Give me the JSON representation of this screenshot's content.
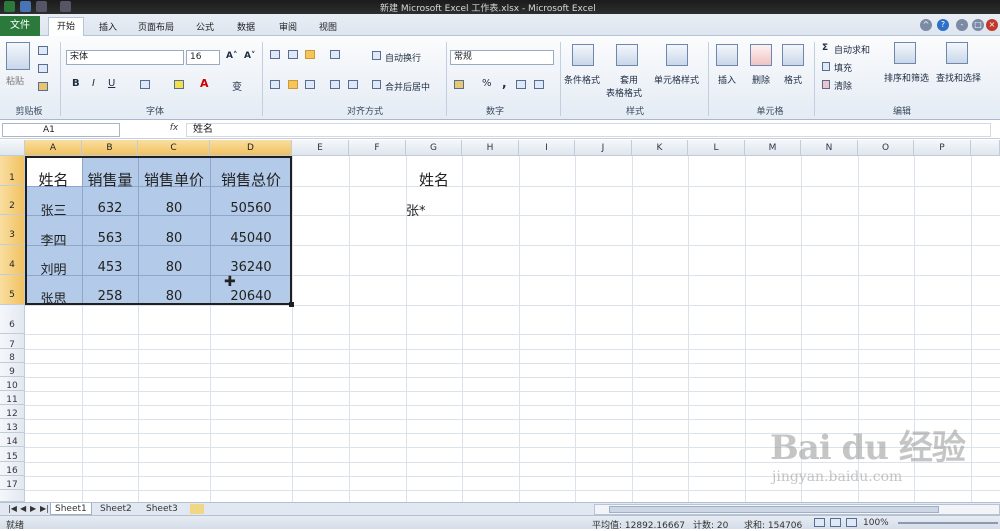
{
  "window": {
    "title": "新建 Microsoft Excel 工作表.xlsx - Microsoft Excel"
  },
  "ribbon_tabs": [
    "文件",
    "开始",
    "插入",
    "页面布局",
    "公式",
    "数据",
    "审阅",
    "视图"
  ],
  "ribbon": {
    "clipboard": {
      "paste": "粘贴",
      "group": "剪贴板"
    },
    "font": {
      "name": "宋体",
      "size": "16",
      "bold": "B",
      "italic": "I",
      "underline": "U",
      "group": "字体"
    },
    "alignment": {
      "wrap": "自动换行",
      "merge": "合并后居中",
      "group": "对齐方式"
    },
    "number": {
      "format": "常规",
      "percent": "%",
      "comma": ",",
      "group": "数字"
    },
    "styles": {
      "conditional": "条件格式",
      "table1": "套用",
      "table2": "表格格式",
      "cell_styles": "单元格样式",
      "group": "样式"
    },
    "cells": {
      "insert": "插入",
      "delete": "删除",
      "format": "格式",
      "group": "单元格"
    },
    "editing": {
      "autosum": "自动求和",
      "fill": "填充",
      "clear": "清除",
      "sort": "排序和筛选",
      "find": "查找和选择",
      "group": "编辑"
    }
  },
  "formula_bar": {
    "name_box": "A1",
    "fx": "fx",
    "value": "姓名"
  },
  "columns": [
    "A",
    "B",
    "C",
    "D",
    "E",
    "F",
    "G",
    "H",
    "I",
    "J",
    "K",
    "L",
    "M",
    "N",
    "O",
    "P"
  ],
  "rows": [
    "1",
    "2",
    "3",
    "4",
    "5",
    "6",
    "7",
    "8",
    "9",
    "10",
    "11",
    "12",
    "13",
    "14",
    "15",
    "16",
    "17"
  ],
  "table": {
    "headers": [
      "姓名",
      "销售量",
      "销售单价",
      "销售总价"
    ],
    "rows": [
      [
        "张三",
        "632",
        "80",
        "50560"
      ],
      [
        "李四",
        "563",
        "80",
        "45040"
      ],
      [
        "刘明",
        "453",
        "80",
        "36240"
      ],
      [
        "张思",
        "258",
        "80",
        "20640"
      ]
    ]
  },
  "side": {
    "g1": "姓名",
    "g2": "张*"
  },
  "sheets": [
    "Sheet1",
    "Sheet2",
    "Sheet3"
  ],
  "status": {
    "ready": "就绪",
    "average": "平均值: 12892.16667",
    "count": "计数: 20",
    "sum": "求和: 154706",
    "zoom": "100%"
  },
  "watermark": {
    "brand": "Bai du 经验",
    "url": "jingyan.baidu.com"
  }
}
